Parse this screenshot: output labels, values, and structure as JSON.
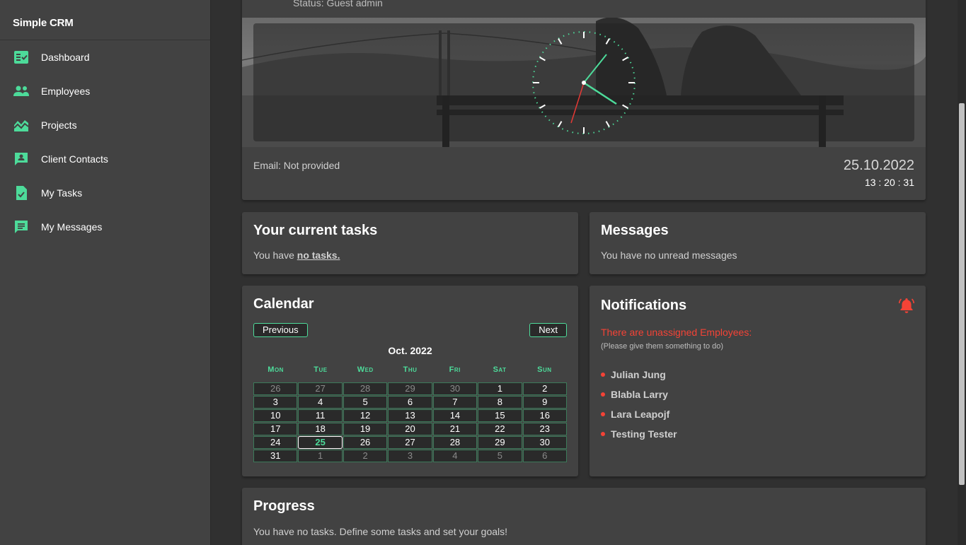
{
  "app": {
    "title": "Simple CRM"
  },
  "sidebar": {
    "items": [
      {
        "label": "Dashboard",
        "icon": "dashboard-icon"
      },
      {
        "label": "Employees",
        "icon": "people-icon"
      },
      {
        "label": "Projects",
        "icon": "chart-area-icon"
      },
      {
        "label": "Client Contacts",
        "icon": "contact-card-icon"
      },
      {
        "label": "My Tasks",
        "icon": "task-check-icon"
      },
      {
        "label": "My Messages",
        "icon": "message-icon"
      }
    ]
  },
  "profile": {
    "status": "Status: Guest admin",
    "email": "Email: Not provided",
    "date": "25.10.2022",
    "time": "13 : 20 : 31"
  },
  "tasks": {
    "title": "Your current tasks",
    "prefix": "You have ",
    "link": "no tasks."
  },
  "messages": {
    "title": "Messages",
    "text": "You have no unread messages"
  },
  "calendar": {
    "title": "Calendar",
    "prev_label": "Previous",
    "next_label": "Next",
    "month": "Oct. 2022",
    "weekdays": [
      "Mon",
      "Tue",
      "Wed",
      "Thu",
      "Fri",
      "Sat",
      "Sun"
    ],
    "today": 25,
    "days": [
      {
        "d": "26",
        "other": true
      },
      {
        "d": "27",
        "other": true
      },
      {
        "d": "28",
        "other": true
      },
      {
        "d": "29",
        "other": true
      },
      {
        "d": "30",
        "other": true
      },
      {
        "d": "1"
      },
      {
        "d": "2"
      },
      {
        "d": "3"
      },
      {
        "d": "4"
      },
      {
        "d": "5"
      },
      {
        "d": "6"
      },
      {
        "d": "7"
      },
      {
        "d": "8"
      },
      {
        "d": "9"
      },
      {
        "d": "10"
      },
      {
        "d": "11"
      },
      {
        "d": "12"
      },
      {
        "d": "13"
      },
      {
        "d": "14"
      },
      {
        "d": "15"
      },
      {
        "d": "16"
      },
      {
        "d": "17"
      },
      {
        "d": "18"
      },
      {
        "d": "19"
      },
      {
        "d": "20"
      },
      {
        "d": "21"
      },
      {
        "d": "22"
      },
      {
        "d": "23"
      },
      {
        "d": "24"
      },
      {
        "d": "25",
        "today": true
      },
      {
        "d": "26"
      },
      {
        "d": "27"
      },
      {
        "d": "28"
      },
      {
        "d": "29"
      },
      {
        "d": "30"
      },
      {
        "d": "31"
      },
      {
        "d": "1",
        "other": true
      },
      {
        "d": "2",
        "other": true
      },
      {
        "d": "3",
        "other": true
      },
      {
        "d": "4",
        "other": true
      },
      {
        "d": "5",
        "other": true
      },
      {
        "d": "6",
        "other": true
      }
    ]
  },
  "notifications": {
    "title": "Notifications",
    "alert": "There are unassigned Employees:",
    "hint": "(Please give them something to do)",
    "employees": [
      "Julian Jung",
      "Blabla Larry",
      "Lara Leapojf",
      "Testing Tester"
    ]
  },
  "progress": {
    "title": "Progress",
    "text": "You have no tasks. Define some tasks and set your goals!"
  },
  "colors": {
    "accent": "#4ddb9a",
    "alert": "#f44336",
    "card": "#424242",
    "background": "#303030"
  }
}
